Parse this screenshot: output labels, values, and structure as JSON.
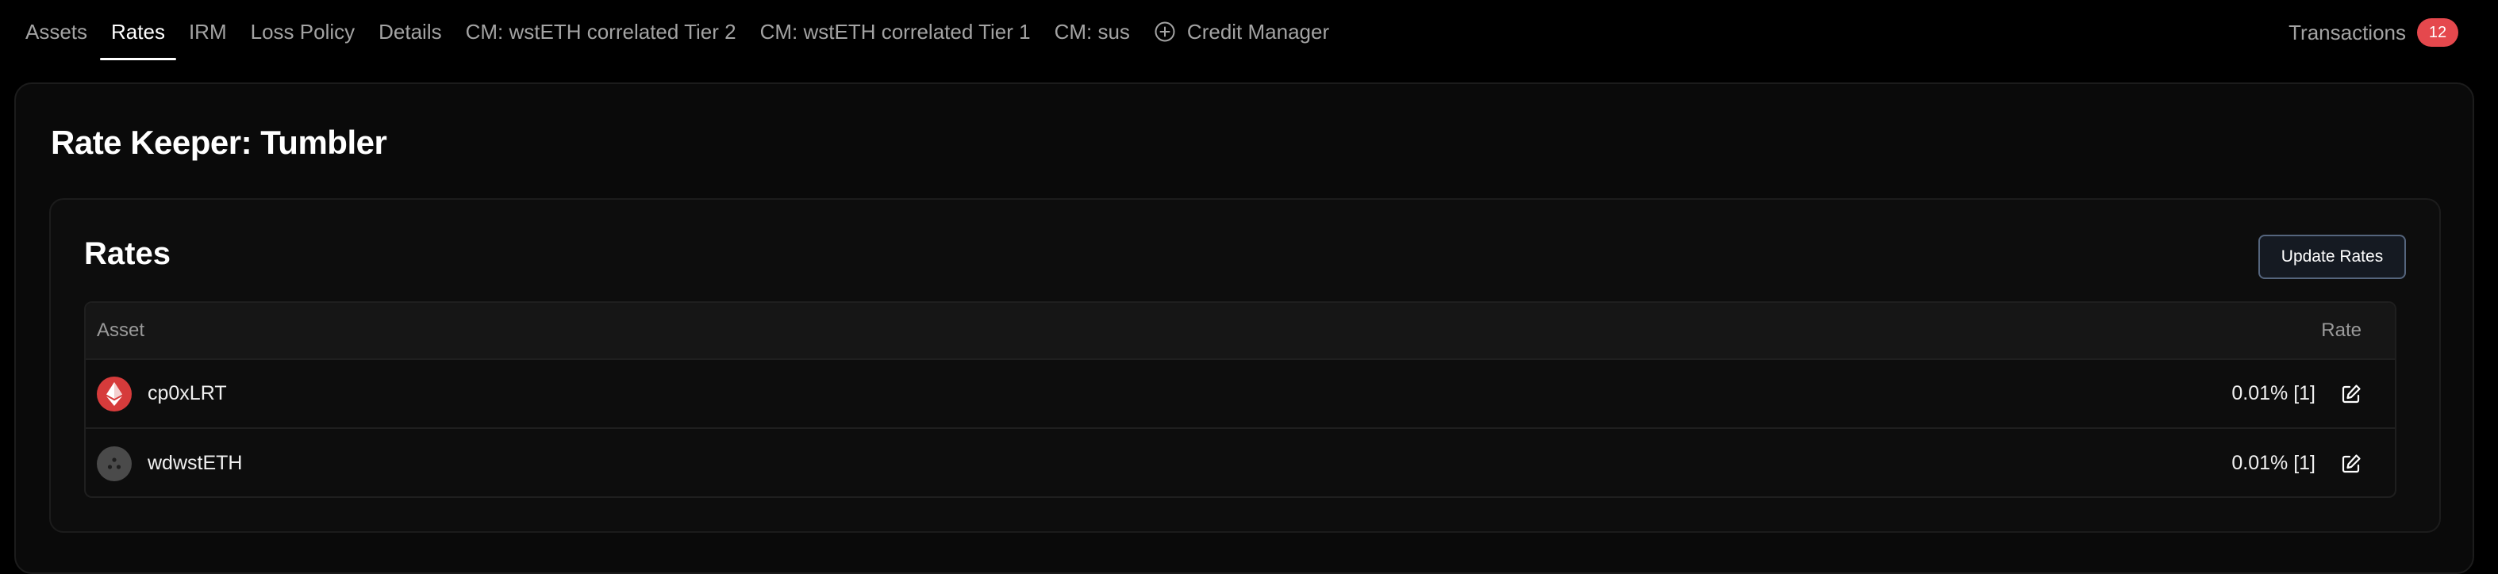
{
  "nav": {
    "tabs": [
      {
        "label": "Assets"
      },
      {
        "label": "Rates"
      },
      {
        "label": "IRM"
      },
      {
        "label": "Loss Policy"
      },
      {
        "label": "Details"
      },
      {
        "label": "CM: wstETH correlated Tier 2"
      },
      {
        "label": "CM: wstETH correlated Tier 1"
      },
      {
        "label": "CM: sus"
      },
      {
        "label": "Credit Manager"
      }
    ],
    "active_tab": "Rates",
    "transactions_label": "Transactions",
    "transactions_count": "12"
  },
  "page": {
    "title": "Rate Keeper: Tumbler"
  },
  "rates": {
    "title": "Rates",
    "update_button": "Update Rates",
    "columns": {
      "asset": "Asset",
      "rate": "Rate"
    },
    "rows": [
      {
        "asset": "cp0xLRT",
        "rate": "0.01% [1]",
        "icon": "ethereum-icon"
      },
      {
        "asset": "wdwstETH",
        "rate": "0.01% [1]",
        "icon": "generic-token-icon"
      }
    ]
  },
  "colors": {
    "background": "#000000",
    "card": "#0a0a0a",
    "badge": "#e5484d",
    "eth_icon": "#d63b3b",
    "button_border": "#55657d"
  }
}
